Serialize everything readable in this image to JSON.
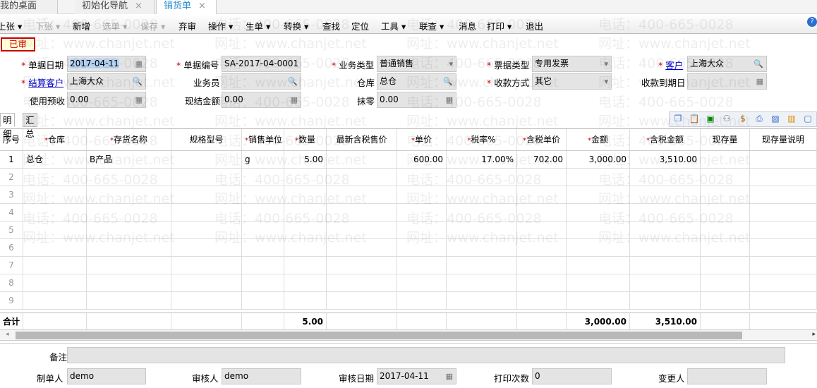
{
  "tabs": [
    {
      "label": "我的桌面"
    },
    {
      "label": "初始化导航",
      "close": "×"
    },
    {
      "label": "销货单",
      "close": "×"
    }
  ],
  "toolbar": {
    "items": [
      {
        "label": "上张 ▾",
        "disabled": false
      },
      {
        "label": "下张 ▾",
        "disabled": true
      },
      {
        "label": "新增",
        "disabled": false
      },
      {
        "label": "选单 ▾",
        "disabled": true
      },
      {
        "label": "保存 ▾",
        "disabled": true
      },
      {
        "label": "弃审",
        "disabled": false
      },
      {
        "label": "操作 ▾",
        "disabled": false
      },
      {
        "label": "生单 ▾",
        "disabled": false
      },
      {
        "label": "转换 ▾",
        "disabled": false
      },
      {
        "label": "查找",
        "disabled": false
      },
      {
        "label": "定位",
        "disabled": false
      },
      {
        "label": "工具 ▾",
        "disabled": false
      },
      {
        "label": "联查 ▾",
        "disabled": false
      },
      {
        "label": "消息",
        "disabled": false
      },
      {
        "label": "打印 ▾",
        "disabled": false
      },
      {
        "label": "退出",
        "disabled": false
      }
    ],
    "help": "?"
  },
  "status_stamp": "已审",
  "form": {
    "doc_date": {
      "label": "单据日期",
      "value": "2017-04-11"
    },
    "doc_no": {
      "label": "单据编号",
      "value": "SA-2017-04-0001"
    },
    "biz_type": {
      "label": "业务类型",
      "value": "普通销售"
    },
    "invoice_type": {
      "label": "票据类型",
      "value": "专用发票"
    },
    "customer": {
      "label": "客户",
      "value": "上海大众"
    },
    "settle_customer": {
      "label": "结算客户",
      "value": "上海大众"
    },
    "salesperson": {
      "label": "业务员",
      "value": ""
    },
    "warehouse": {
      "label": "仓库",
      "value": "总仓"
    },
    "pay_method": {
      "label": "收款方式",
      "value": "其它"
    },
    "due_date": {
      "label": "收款到期日",
      "value": ""
    },
    "use_prepay": {
      "label": "使用预收",
      "value": "0.00"
    },
    "cash_amount": {
      "label": "现结金额",
      "value": "0.00"
    },
    "rounding": {
      "label": "抹零",
      "value": "0.00"
    }
  },
  "subtabs": [
    "明细",
    "汇总"
  ],
  "grid": {
    "columns": [
      {
        "label": "序号"
      },
      {
        "label": "仓库",
        "req": true
      },
      {
        "label": "存货名称",
        "req": true
      },
      {
        "label": "规格型号"
      },
      {
        "label": "销售单位",
        "req": true
      },
      {
        "label": "数量",
        "req": true
      },
      {
        "label": "最新含税售价"
      },
      {
        "label": "单价",
        "req": true
      },
      {
        "label": "税率%",
        "req": true
      },
      {
        "label": "含税单价",
        "req": true
      },
      {
        "label": "金额",
        "req": true
      },
      {
        "label": "含税金额",
        "req": true
      },
      {
        "label": "现存量"
      },
      {
        "label": "现存量说明"
      }
    ],
    "rows": [
      [
        "1",
        "总仓",
        "B产品",
        "",
        "g",
        "5.00",
        "",
        "600.00",
        "17.00%",
        "702.00",
        "3,000.00",
        "3,510.00",
        "",
        ""
      ],
      [
        "2"
      ],
      [
        "3"
      ],
      [
        "4"
      ],
      [
        "5"
      ],
      [
        "6"
      ],
      [
        "7"
      ],
      [
        "8"
      ],
      [
        "9"
      ]
    ],
    "totals": [
      "合计",
      "",
      "",
      "",
      "",
      "5.00",
      "",
      "",
      "",
      "",
      "3,000.00",
      "3,510.00",
      "",
      ""
    ]
  },
  "footer": {
    "remark": {
      "label": "备注",
      "value": ""
    },
    "maker": {
      "label": "制单人",
      "value": "demo"
    },
    "auditor": {
      "label": "审核人",
      "value": "demo"
    },
    "audit_date": {
      "label": "审核日期",
      "value": "2017-04-11"
    },
    "print_count": {
      "label": "打印次数",
      "value": "0"
    },
    "changer": {
      "label": "变更人",
      "value": ""
    }
  },
  "watermark": {
    "phone": "电话：400-665-0028",
    "site": "网址：www.chanjet.net"
  }
}
